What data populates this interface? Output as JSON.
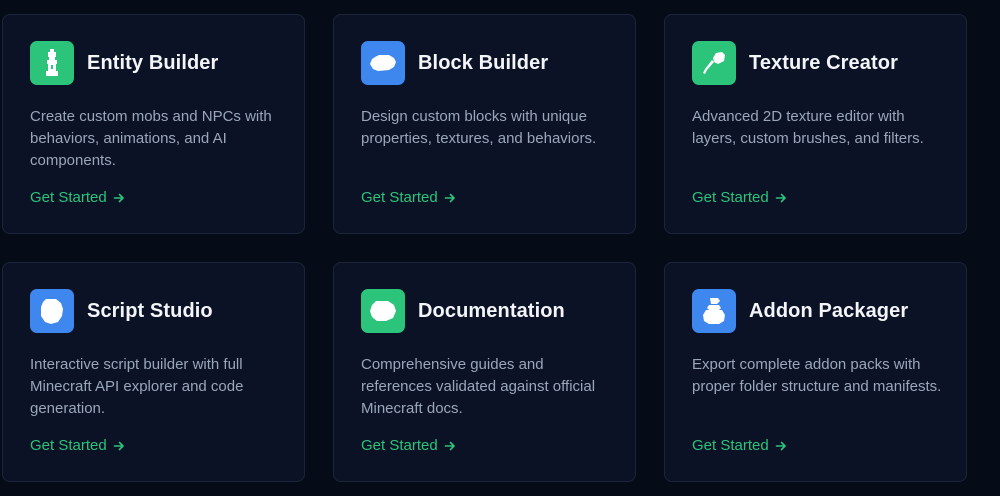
{
  "colors": {
    "background": "#060b18",
    "card": "#0b1225",
    "card_border": "#1c2538",
    "accent_green": "#2bc47a",
    "accent_blue": "#3d87ee"
  },
  "cards": [
    {
      "title": "Entity Builder",
      "description": "Create custom mobs and NPCs with behaviors, animations, and AI components.",
      "cta": "Get Started",
      "icon": "entity-icon",
      "icon_color": "#2bc47a"
    },
    {
      "title": "Block Builder",
      "description": "Design custom blocks with unique properties, textures, and behaviors.",
      "cta": "Get Started",
      "icon": "block-icon",
      "icon_color": "#3d87ee"
    },
    {
      "title": "Texture Creator",
      "description": "Advanced 2D texture editor with layers, custom brushes, and filters.",
      "cta": "Get Started",
      "icon": "brush-icon",
      "icon_color": "#2bc47a"
    },
    {
      "title": "Script Studio",
      "description": "Interactive script builder with full Minecraft API explorer and code generation.",
      "cta": "Get Started",
      "icon": "script-icon",
      "icon_color": "#3d87ee"
    },
    {
      "title": "Documentation",
      "description": "Comprehensive guides and references validated against official Minecraft docs.",
      "cta": "Get Started",
      "icon": "book-icon",
      "icon_color": "#2bc47a"
    },
    {
      "title": "Addon Packager",
      "description": "Export complete addon packs with proper folder structure and manifests.",
      "cta": "Get Started",
      "icon": "package-icon",
      "icon_color": "#3d87ee"
    }
  ]
}
